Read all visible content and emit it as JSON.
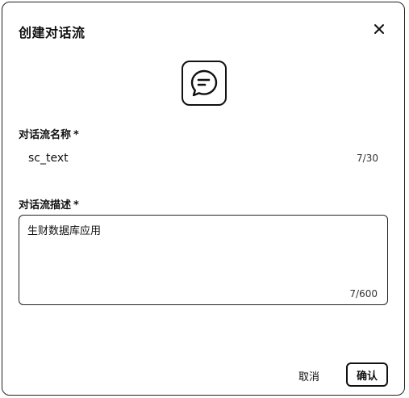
{
  "dialog": {
    "title": "创建对话流",
    "close_icon": "close-icon",
    "avatar_icon": "chat-bubble-icon"
  },
  "form": {
    "name_label": "对话流名称",
    "name_required": "*",
    "name_value": "sc_text",
    "name_counter": "7/30",
    "desc_label": "对话流描述",
    "desc_required": "*",
    "desc_value": "生财数据库应用",
    "desc_counter": "7/600"
  },
  "footer": {
    "cancel_label": "取消",
    "confirm_label": "确认"
  }
}
